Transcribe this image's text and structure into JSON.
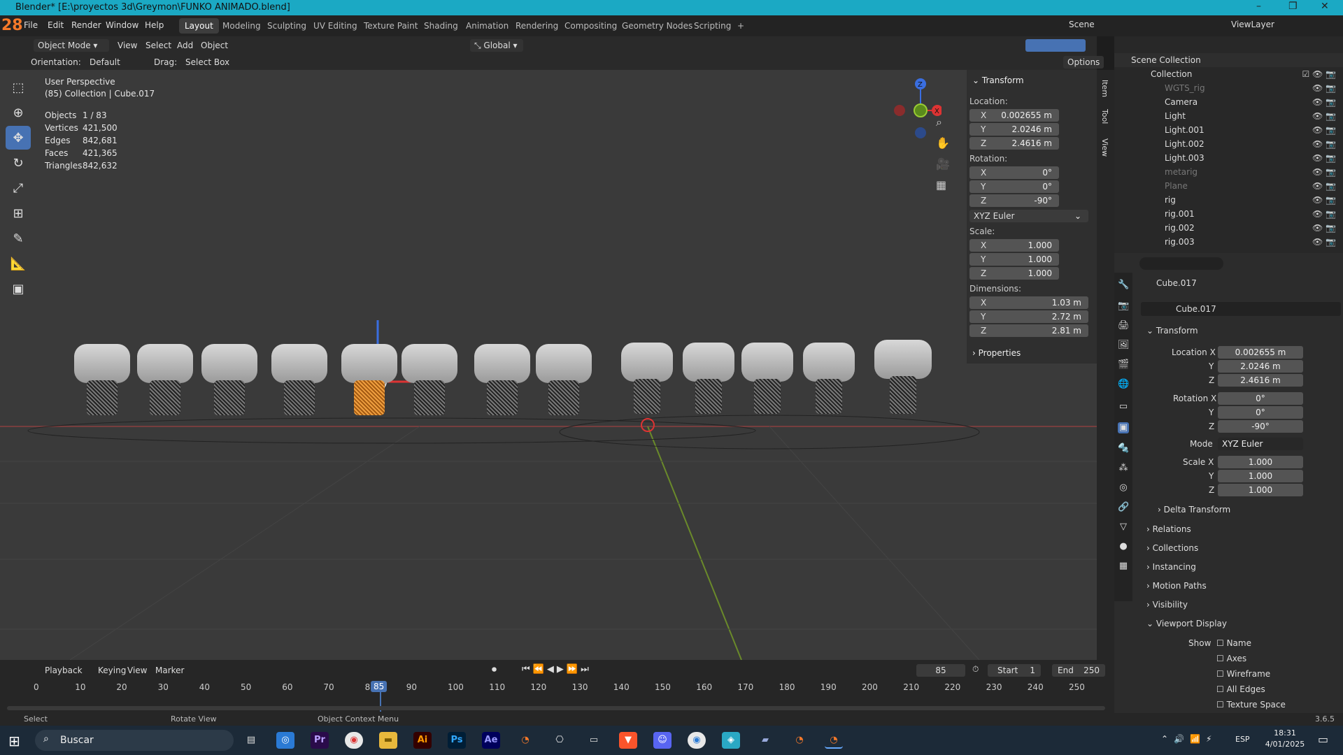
{
  "window": {
    "title": "Blender* [E:\\proyectos 3d\\Greymon\\FUNKO ANIMADO.blend]",
    "minimize": "–",
    "maximize": "❐",
    "close": "✕"
  },
  "topbar": {
    "logo": "28",
    "menus": [
      "File",
      "Edit",
      "Render",
      "Window",
      "Help"
    ],
    "workspaces": [
      "Layout",
      "Modeling",
      "Sculpting",
      "UV Editing",
      "Texture Paint",
      "Shading",
      "Animation",
      "Rendering",
      "Compositing",
      "Geometry Nodes",
      "Scripting",
      "+"
    ],
    "scene": "Scene",
    "view_layer": "ViewLayer"
  },
  "viewport_header": {
    "mode": "Object Mode",
    "menus": [
      "View",
      "Select",
      "Add",
      "Object"
    ],
    "transform_orientation": "Global"
  },
  "tool_header": {
    "orientation_label": "Orientation:",
    "orientation_value": "Default",
    "drag_label": "Drag:",
    "drag_value": "Select Box",
    "options": "Options"
  },
  "overlay": {
    "perspective": "User Perspective",
    "collection": "(85) Collection | Cube.017",
    "stats": [
      {
        "k": "Objects",
        "v": "1 / 83"
      },
      {
        "k": "Vertices",
        "v": "421,500"
      },
      {
        "k": "Edges",
        "v": "842,681"
      },
      {
        "k": "Faces",
        "v": "421,365"
      },
      {
        "k": "Triangles",
        "v": "842,632"
      }
    ]
  },
  "gizmo": {
    "z": "Z",
    "x": "X"
  },
  "npanel": {
    "tabs": [
      "Item",
      "Tool",
      "View"
    ],
    "header": "Transform",
    "location_label": "Location:",
    "location": [
      {
        "a": "X",
        "v": "0.002655 m"
      },
      {
        "a": "Y",
        "v": "2.0246 m"
      },
      {
        "a": "Z",
        "v": "2.4616 m"
      }
    ],
    "rotation_label": "Rotation:",
    "rotation": [
      {
        "a": "X",
        "v": "0°"
      },
      {
        "a": "Y",
        "v": "0°"
      },
      {
        "a": "Z",
        "v": "-90°"
      }
    ],
    "rotation_mode": "XYZ Euler",
    "scale_label": "Scale:",
    "scale": [
      {
        "a": "X",
        "v": "1.000"
      },
      {
        "a": "Y",
        "v": "1.000"
      },
      {
        "a": "Z",
        "v": "1.000"
      }
    ],
    "dimensions_label": "Dimensions:",
    "dimensions": [
      {
        "a": "X",
        "v": "1.03 m"
      },
      {
        "a": "Y",
        "v": "2.72 m"
      },
      {
        "a": "Z",
        "v": "2.81 m"
      }
    ],
    "properties": "Properties"
  },
  "outliner": {
    "root": "Scene Collection",
    "collection": "Collection",
    "items": [
      {
        "name": "WGTS_rig",
        "dim": true
      },
      {
        "name": "Camera"
      },
      {
        "name": "Light"
      },
      {
        "name": "Light.001"
      },
      {
        "name": "Light.002"
      },
      {
        "name": "Light.003"
      },
      {
        "name": "metarig",
        "dim": true
      },
      {
        "name": "Plane",
        "dim": true
      },
      {
        "name": "rig"
      },
      {
        "name": "rig.001"
      },
      {
        "name": "rig.002"
      },
      {
        "name": "rig.003"
      }
    ]
  },
  "properties": {
    "object_name": "Cube.017",
    "data_name": "Cube.017",
    "transform": "Transform",
    "location_x_label": "Location X",
    "loc": [
      "0.002655 m",
      "2.0246 m",
      "2.4616 m"
    ],
    "rotation_x_label": "Rotation X",
    "rot": [
      "0°",
      "0°",
      "-90°"
    ],
    "mode_label": "Mode",
    "mode": "XYZ Euler",
    "scale_x_label": "Scale X",
    "scl": [
      "1.000",
      "1.000",
      "1.000"
    ],
    "axis_y": "Y",
    "axis_z": "Z",
    "delta": "Delta Transform",
    "sections": [
      "Relations",
      "Collections",
      "Instancing",
      "Motion Paths",
      "Visibility"
    ],
    "viewport_display": "Viewport Display",
    "show_label": "Show",
    "show_items": [
      "Name",
      "Axes",
      "Wireframe",
      "All Edges",
      "Texture Space"
    ]
  },
  "timeline": {
    "menus": [
      "Playback",
      "Keying",
      "View",
      "Marker"
    ],
    "current_frame": "85",
    "start_label": "Start",
    "start": "1",
    "end_label": "End",
    "end": "250",
    "ticks": [
      "0",
      "10",
      "20",
      "30",
      "40",
      "50",
      "60",
      "70",
      "80",
      "90",
      "100",
      "110",
      "120",
      "130",
      "140",
      "150",
      "160",
      "170",
      "180",
      "190",
      "200",
      "210",
      "220",
      "230",
      "240",
      "250"
    ]
  },
  "statusbar": {
    "select": "Select",
    "rotate": "Rotate View",
    "context": "Object Context Menu",
    "version": "3.6.5"
  },
  "taskbar": {
    "search": "Buscar",
    "lang": "ESP",
    "time": "18:31",
    "date": "4/01/2025"
  }
}
